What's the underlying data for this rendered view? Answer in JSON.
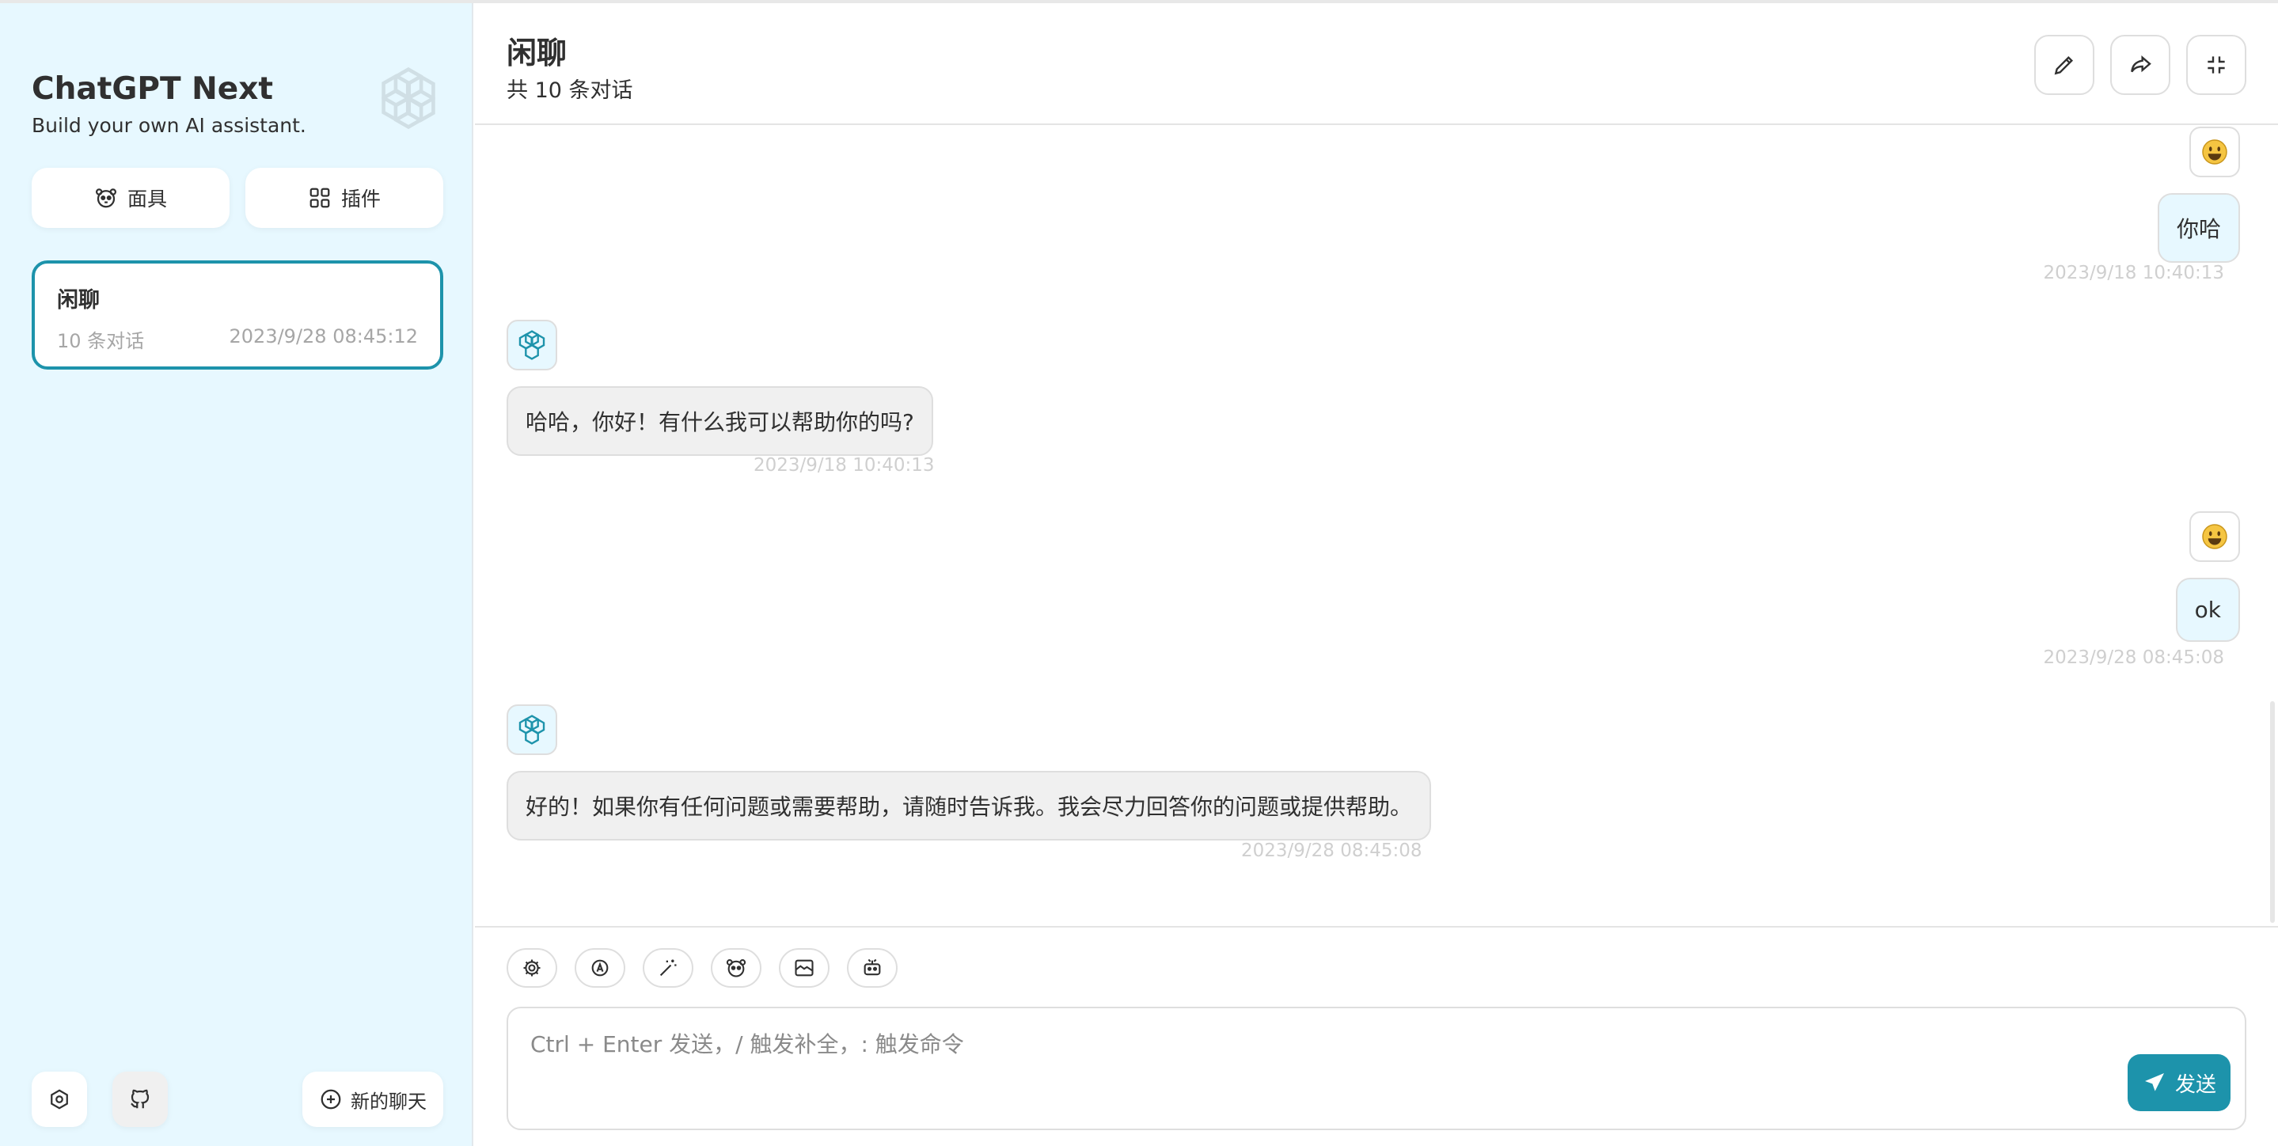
{
  "sidebar": {
    "title": "ChatGPT Next",
    "subtitle": "Build your own AI assistant.",
    "logo_icon": "openai-logo-icon",
    "buttons": [
      {
        "label": "面具",
        "icon": "mask-icon"
      },
      {
        "label": "插件",
        "icon": "grid-icon"
      }
    ],
    "chats": [
      {
        "title": "闲聊",
        "count": "10 条对话",
        "time": "2023/9/28 08:45:12"
      }
    ],
    "footer": {
      "settings_icon": "settings-icon",
      "github_icon": "github-icon",
      "new_chat_label": "新的聊天"
    }
  },
  "header": {
    "title": "闲聊",
    "subtitle": "共 10 条对话",
    "actions": [
      "edit-icon",
      "share-icon",
      "collapse-icon"
    ]
  },
  "messages": [
    {
      "role": "user",
      "text": "你哈",
      "time": "2023/9/18 10:40:13"
    },
    {
      "role": "assistant",
      "text": "哈哈，你好！有什么我可以帮助你的吗?",
      "time": "2023/9/18 10:40:13"
    },
    {
      "role": "user",
      "text": "ok",
      "time": "2023/9/28 08:45:08"
    },
    {
      "role": "assistant",
      "text": "好的！如果你有任何问题或需要帮助，请随时告诉我。我会尽力回答你的问题或提供帮助。",
      "time": "2023/9/28 08:45:08"
    }
  ],
  "composer": {
    "tools": [
      "settings-icon",
      "auto-theme-icon",
      "magic-prompt-icon",
      "mask-icon",
      "image-icon",
      "robot-icon"
    ],
    "placeholder": "Ctrl + Enter 发送，/ 触发补全，: 触发命令",
    "send_label": "发送"
  },
  "colors": {
    "accent": "#1d93ab",
    "sidebar_bg": "#e7f8ff",
    "user_bubble": "#e7f8ff",
    "bot_bubble": "#f0f0f0"
  }
}
